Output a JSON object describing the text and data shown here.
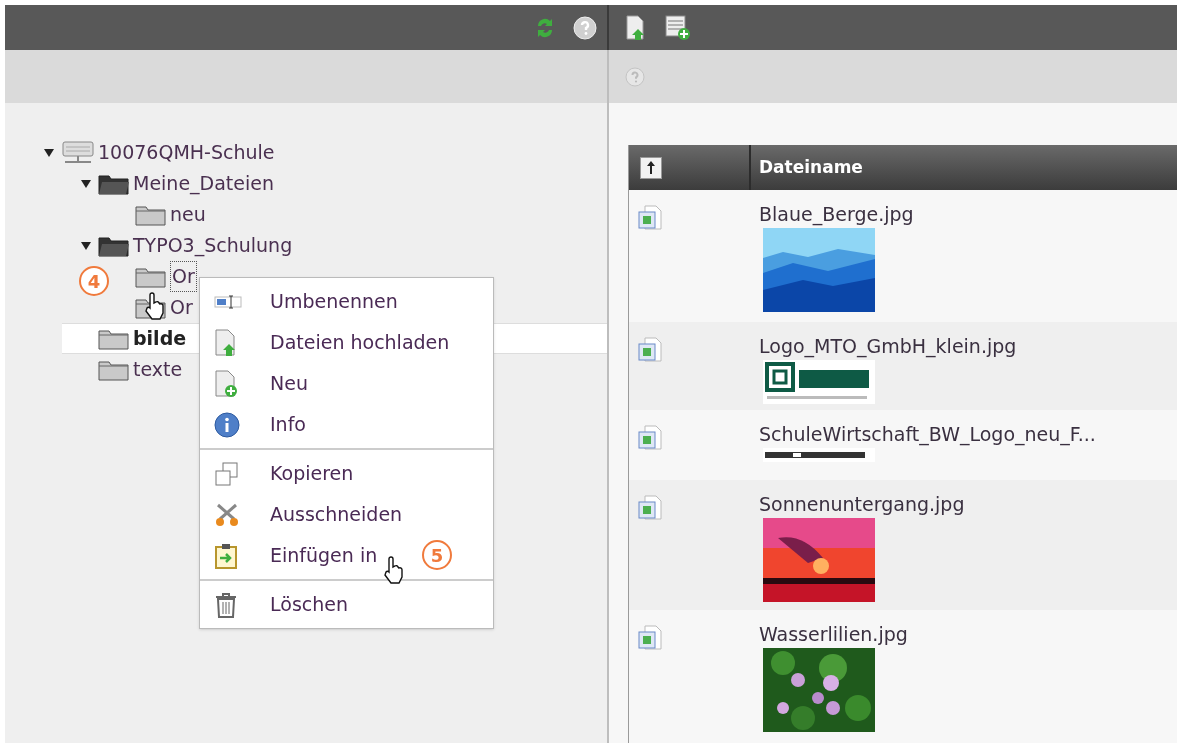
{
  "tree": {
    "label": "10076QMH-Schule",
    "expanded": true,
    "selected": false,
    "children": [
      {
        "label": "Meine_Dateien",
        "expanded": true,
        "selected": false,
        "children": [
          {
            "label": "neu",
            "selected": false
          }
        ]
      },
      {
        "label": "TYPO3_Schulung",
        "expanded": true,
        "selected": false,
        "children": [
          {
            "label": "Or",
            "selected": false,
            "focused": true,
            "marker": "4"
          },
          {
            "label": "Or",
            "selected": false
          }
        ]
      },
      {
        "label": "bilde",
        "selected": true
      },
      {
        "label": "texte",
        "selected": false
      }
    ]
  },
  "context_menu": [
    [
      {
        "label": "Umbenennen"
      },
      {
        "label": "Dateien hochladen"
      },
      {
        "label": "Neu"
      },
      {
        "label": "Info"
      }
    ],
    [
      {
        "label": "Kopieren"
      },
      {
        "label": "Ausschneiden"
      },
      {
        "label": "Einfügen in",
        "marker": "5"
      }
    ],
    [
      {
        "label": "Löschen"
      }
    ]
  ],
  "table": {
    "columns": [
      "Dateiname"
    ],
    "rows": [
      {
        "name": "Blaue_Berge.jpg"
      },
      {
        "name": "Logo_MTO_GmbH_klein.jpg"
      },
      {
        "name": "SchuleWirtschaft_BW_Logo_neu_F..."
      },
      {
        "name": "Sonnenuntergang.jpg"
      },
      {
        "name": "Wasserlilien.jpg"
      }
    ]
  }
}
